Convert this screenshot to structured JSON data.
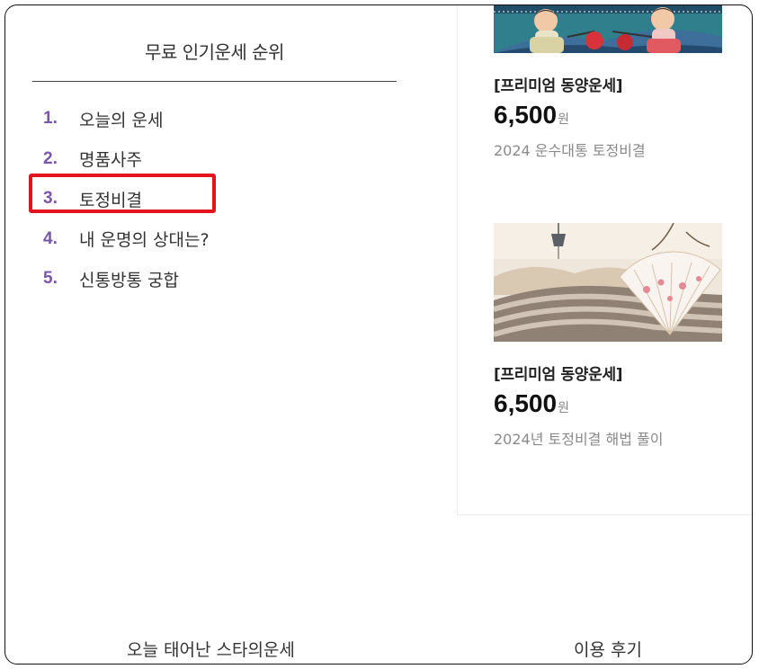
{
  "ranking": {
    "title": "무료 인기운세 순위",
    "items": [
      {
        "num": "1.",
        "label": "오늘의 운세"
      },
      {
        "num": "2.",
        "label": "명품사주"
      },
      {
        "num": "3.",
        "label": "토정비결"
      },
      {
        "num": "4.",
        "label": "내 운명의 상대는?"
      },
      {
        "num": "5.",
        "label": "신통방통 궁합"
      }
    ],
    "highlight_color": "#e3141b",
    "number_color": "#7a55a8"
  },
  "products": [
    {
      "category": "[프리미엄 동양운세]",
      "price": "6,500",
      "unit": "원",
      "desc": "2024 운수대통 토정비결",
      "image": "illustration of children in hanbok with lanterns"
    },
    {
      "category": "[프리미엄 동양운세]",
      "price": "6,500",
      "unit": "원",
      "desc": "2024년 토정비결 해법 풀이",
      "image": "traditional roof tiles with folding fan and wind chime"
    }
  ],
  "bottom_nav": {
    "left": "오늘 태어난 스타의운세",
    "right": "이용 후기"
  }
}
